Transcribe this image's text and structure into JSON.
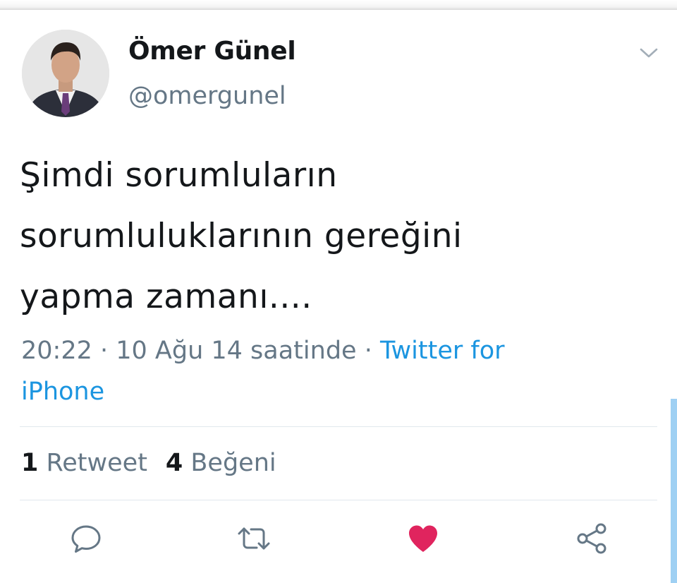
{
  "tweet": {
    "author": {
      "name": "Ömer Günel",
      "handle": "@omergunel"
    },
    "text_lines": [
      "Şimdi sorumluların",
      "sorumluluklarının gereğini",
      "yapma zamanı...."
    ],
    "meta": {
      "time": "20:22",
      "separator": " · ",
      "date_text": "10 Ağu 14 saatinde",
      "source_line1": "Twitter for",
      "source_line2": "iPhone"
    },
    "stats": {
      "retweet_count": "1",
      "retweet_label": "Retweet",
      "like_count": "4",
      "like_label": "Beğeni"
    },
    "actions": {
      "reply_icon": "reply-icon",
      "retweet_icon": "retweet-icon",
      "like_icon": "heart-icon",
      "share_icon": "share-icon",
      "liked": true
    }
  },
  "colors": {
    "text_primary": "#14171a",
    "text_secondary": "#657786",
    "link": "#1b95e0",
    "like_active": "#e0245e",
    "icon": "#657786",
    "divider": "#e1e8ed"
  }
}
